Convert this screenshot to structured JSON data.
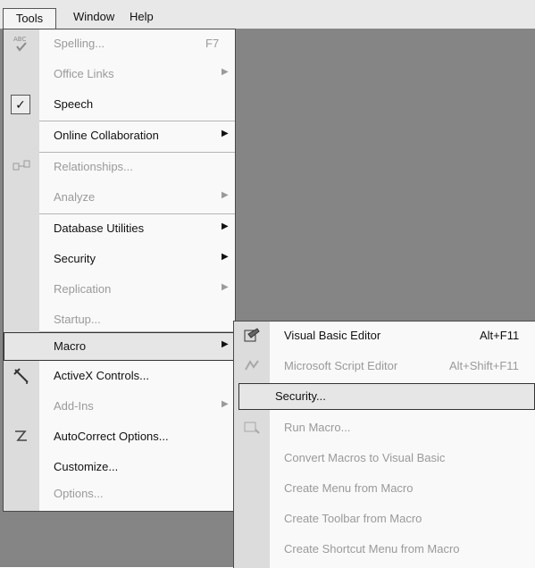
{
  "menubar": {
    "tools": "Tools",
    "window": "Window",
    "help": "Help"
  },
  "tools_menu": {
    "spelling": {
      "label": "Spelling...",
      "shortcut": "F7"
    },
    "office_links": {
      "label": "Office Links"
    },
    "speech": {
      "label": "Speech"
    },
    "online_collab": {
      "label": "Online Collaboration"
    },
    "relationships": {
      "label": "Relationships..."
    },
    "analyze": {
      "label": "Analyze"
    },
    "db_utilities": {
      "label": "Database Utilities"
    },
    "security": {
      "label": "Security"
    },
    "replication": {
      "label": "Replication"
    },
    "startup": {
      "label": "Startup..."
    },
    "macro": {
      "label": "Macro"
    },
    "activex": {
      "label": "ActiveX Controls..."
    },
    "addins": {
      "label": "Add-Ins"
    },
    "autocorrect": {
      "label": "AutoCorrect Options..."
    },
    "customize": {
      "label": "Customize..."
    },
    "options": {
      "label": "Options..."
    }
  },
  "macro_menu": {
    "vb_editor": {
      "label": "Visual Basic Editor",
      "shortcut": "Alt+F11"
    },
    "script_editor": {
      "label": "Microsoft Script Editor",
      "shortcut": "Alt+Shift+F11"
    },
    "security": {
      "label": "Security..."
    },
    "run_macro": {
      "label": "Run Macro..."
    },
    "convert": {
      "label": "Convert Macros to Visual Basic"
    },
    "create_menu": {
      "label": "Create Menu from Macro"
    },
    "create_toolbar": {
      "label": "Create Toolbar from Macro"
    },
    "create_shortcut": {
      "label": "Create Shortcut Menu from Macro"
    }
  },
  "icons": {
    "spelling": "spelling-abc-icon",
    "speech_check": "checkmark-icon",
    "relationships": "relationships-icon",
    "activex": "activex-hammer-icon",
    "autocorrect": "autocorrect-pen-icon",
    "vb_editor": "visual-basic-editor-icon",
    "script_editor": "script-editor-icon",
    "run_macro": "run-macro-icon"
  },
  "colors": {
    "workspace": "#858585",
    "menu_bg": "#f9f9f9",
    "gutter": "#dcdcdc",
    "disabled_text": "#9a9a9a"
  }
}
